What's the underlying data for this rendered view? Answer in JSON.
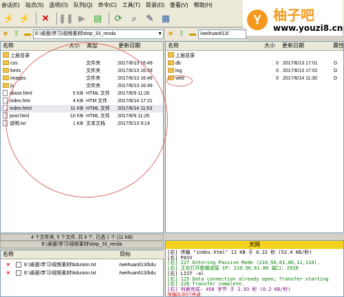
{
  "menu": [
    "会话(E)",
    "站点(S)",
    "选项(O)",
    "队列(Q)",
    "命令(C)",
    "工具(T)",
    "目录(D)",
    "查看(V)",
    "帮助(H)"
  ],
  "toolbar_icons": [
    "connect-icon",
    "disconnect-icon",
    "stop-icon",
    "pause-icon",
    "transfer-icon",
    "queue-icon",
    "refresh-icon",
    "search-icon",
    "edit-icon",
    "view-icon"
  ],
  "logo": {
    "mark": "Y",
    "title": "柚子吧",
    "url": "www.youzi8.cn"
  },
  "local": {
    "path": "E:\\桌面\\学习\\视频素材\\dstp_33_renda",
    "headers": {
      "name": "名称",
      "size": "大小",
      "type": "类型",
      "date": "更新日期"
    },
    "items": [
      {
        "name": "上层目录",
        "size": "",
        "type": "",
        "date": "",
        "kind": "up"
      },
      {
        "name": "css",
        "size": "",
        "type": "文件夹",
        "date": "2017/6/13 16:49",
        "kind": "folder"
      },
      {
        "name": "fonts",
        "size": "",
        "type": "文件夹",
        "date": "2017/6/13 16:49",
        "kind": "folder"
      },
      {
        "name": "images",
        "size": "",
        "type": "文件夹",
        "date": "2017/6/13 16:49",
        "kind": "folder"
      },
      {
        "name": "js",
        "size": "",
        "type": "文件夹",
        "date": "2017/6/13 16:49",
        "kind": "folder"
      },
      {
        "name": "about.html",
        "size": "5 KB",
        "type": "HTML 文件",
        "date": "2017/6/9 11:26",
        "kind": "file"
      },
      {
        "name": "index.htm",
        "size": "4 KB",
        "type": "HTM 文件",
        "date": "2017/6/14 17:21",
        "kind": "file"
      },
      {
        "name": "index.html",
        "size": "11 KB",
        "type": "HTML 文件",
        "date": "2017/6/14 11:53",
        "kind": "file"
      },
      {
        "name": "post.html",
        "size": "10 KB",
        "type": "HTML 文件",
        "date": "2017/6/9 11:26",
        "kind": "file"
      },
      {
        "name": "说明.txt",
        "size": "1 KB",
        "type": "文本文档",
        "date": "2017/5/13 9:14",
        "kind": "file"
      }
    ],
    "status_line1": "4 个文件夹, 5 个文件, 共 9 个, 已选 1 个 (11 KB)",
    "status_line2": "E:\\桌面\\学习\\视频素材\\dstp_33_renda"
  },
  "remote": {
    "path": "/weihuan613/",
    "headers": {
      "name": "名称",
      "size": "大小",
      "date": "更新日期",
      "attr": "属性"
    },
    "items": [
      {
        "name": "上层目录",
        "size": "",
        "date": "",
        "attr": "",
        "kind": "up"
      },
      {
        "name": "db",
        "size": "0",
        "date": "2017/6/13 17:01",
        "attr": "D",
        "kind": "folder"
      },
      {
        "name": "log",
        "size": "0",
        "date": "2017/6/13 17:01",
        "attr": "D",
        "kind": "folder"
      },
      {
        "name": "web",
        "size": "0",
        "date": "2017/6/14 11:30",
        "attr": "D",
        "kind": "folder"
      }
    ],
    "status_title": "天网"
  },
  "queue": {
    "headers": {
      "name": "名称",
      "target": "目标"
    },
    "items": [
      {
        "name": "E:\\桌面\\学习\\视频素材\\bdunion.txt",
        "target": "/weihuan613/bdu"
      },
      {
        "name": "E:\\桌面\\学习\\视频素材\\bdunion.txt",
        "target": "/weihuan613/bdu"
      }
    ]
  },
  "log": [
    {
      "text": "[右] 传输 \"index.html\" 11 KB 于 0.22 秒 (52.4 KB/秒)",
      "color": "#000000"
    },
    {
      "text": "[右] PASV",
      "color": "#000000"
    },
    {
      "text": "[右] 227 Entering Passive Mode (210,56,61,80,11,110).",
      "color": "#008000"
    },
    {
      "text": "[右] 正在打开数据连接 IP: 210.56.61.80 端口: 2926",
      "color": "#008000"
    },
    {
      "text": "[右] LIST -al",
      "color": "#000000"
    },
    {
      "text": "[右] 125 Data connection already open; Transfer starting",
      "color": "#008000"
    },
    {
      "text": "[右] 226 Transfer complete.",
      "color": "#008000"
    },
    {
      "text": "[右] 列表完成: 458 字节 于 2.93 秒 (0.2 KB/秒)",
      "color": "#800080"
    },
    {
      "text": "传输队列已完成",
      "color": "#d00000"
    }
  ]
}
